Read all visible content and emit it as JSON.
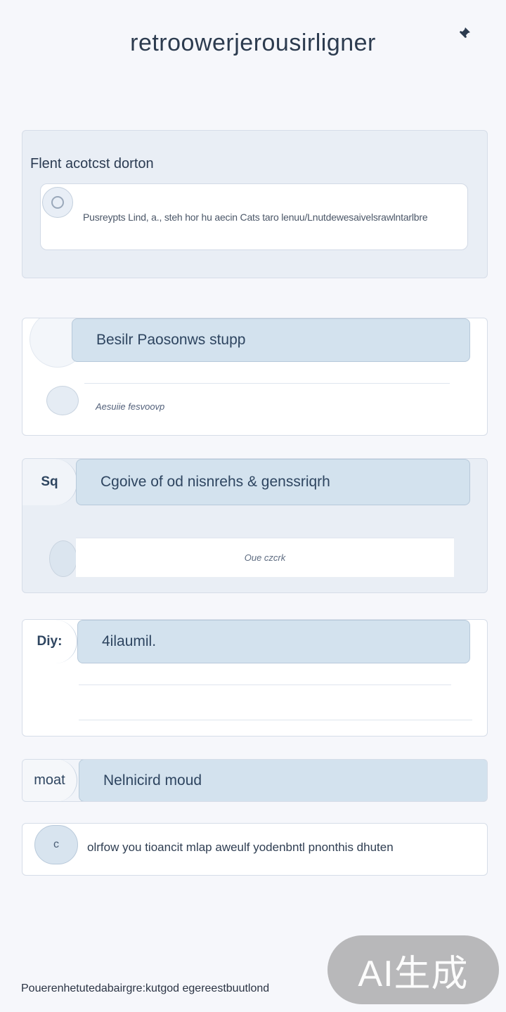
{
  "header": {
    "title": "retroowerjerousirligner",
    "pin_icon": "pin-icon"
  },
  "card1": {
    "title": "Flent acotcst dorton",
    "input_text": "Pusreypts Lind, a., steh hor hu aecin Cats taro lenuu/Lnutdewesaivelsrawlntarlbre",
    "icon": "circle-icon"
  },
  "card2": {
    "band_label": "Besilr Paosonws stupp",
    "subtext": "Aesuiie fesvoovp"
  },
  "card3": {
    "tab_label": "Sq",
    "band_label": "Cgoive of od nisnrehs & genssriqrh",
    "field_text": "Oue czcrk"
  },
  "card4": {
    "tab_label": "Diy:",
    "band_label": "4ilaumil."
  },
  "card5": {
    "tab_label": "moat",
    "band_label": "Nelnicird moud"
  },
  "card6": {
    "icon_glyph": "c",
    "message": "olrfow you tioancit mlap aweulf yodenbntl pnonthis dhuten"
  },
  "footer": {
    "text": "Pouerenhetutedabairgre:kutgod egereestbuutlond"
  },
  "watermark": {
    "text": "AI生成"
  }
}
